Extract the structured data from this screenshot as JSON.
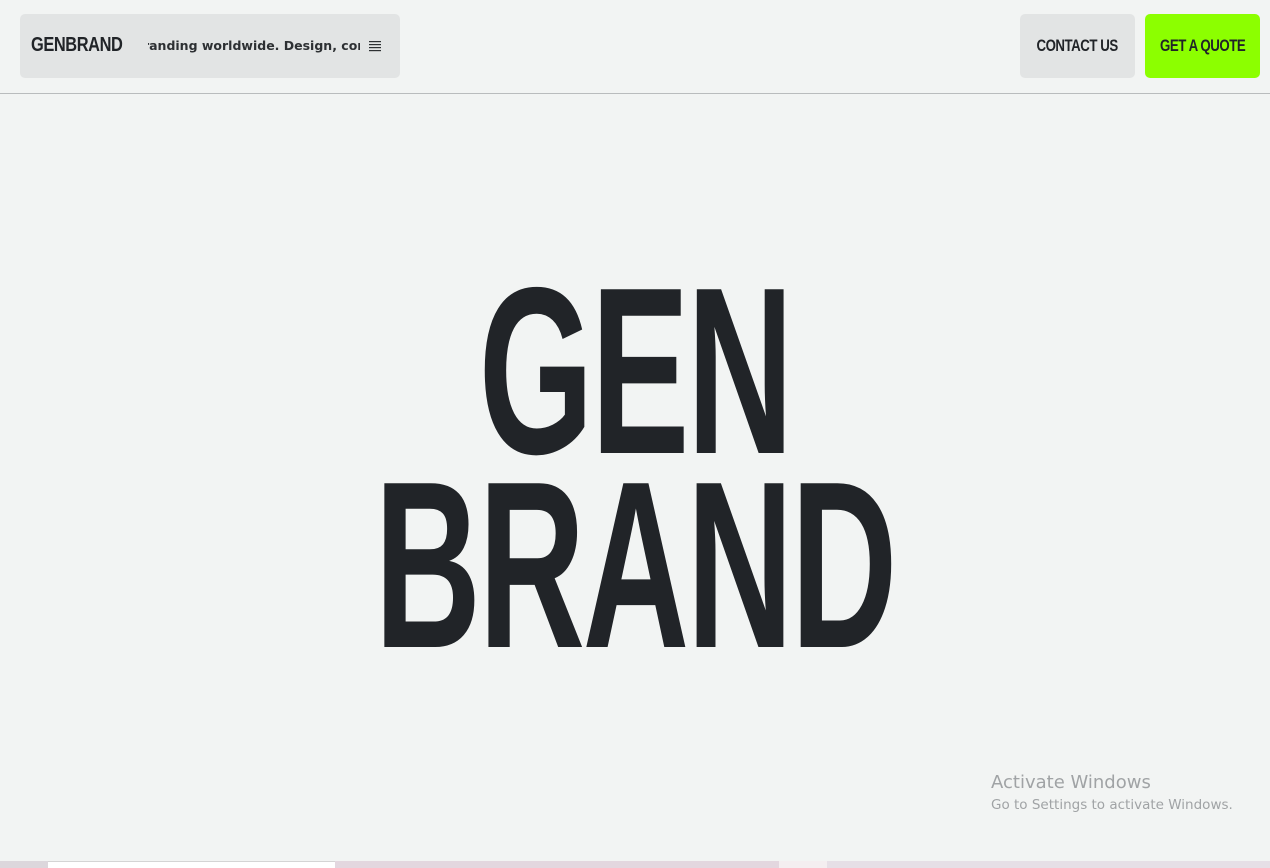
{
  "header": {
    "logo": "GENBRAND",
    "ticker": "branding worldwide. Design, content p",
    "menu_icon": "hamburger-menu-icon",
    "contact_label": "CONTACT US",
    "quote_label": "GET A QUOTE"
  },
  "hero": {
    "line1": "GEN",
    "line2": "BRAND"
  },
  "watermark": {
    "title": "Activate Windows",
    "subtitle": "Go to Settings to activate Windows."
  },
  "colors": {
    "background": "#f2f4f3",
    "text": "#212428",
    "pill": "#e2e4e4",
    "accent": "#8cff00"
  }
}
